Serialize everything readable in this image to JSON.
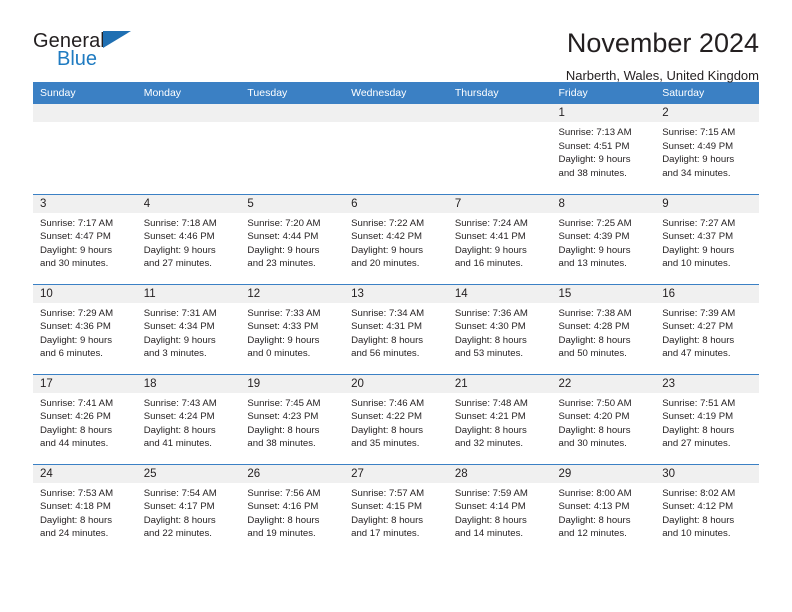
{
  "brand": {
    "name_part1": "General",
    "name_part2": "Blue",
    "mark": "triangle-logo",
    "accent_color": "#1f7bc1"
  },
  "header": {
    "title": "November 2024",
    "subtitle": "Narberth, Wales, United Kingdom"
  },
  "theme": {
    "header_row_bg": "#3b80c4",
    "daynum_strip_bg": "#f0f0f0",
    "text_color": "#231f20"
  },
  "weekdays": [
    "Sunday",
    "Monday",
    "Tuesday",
    "Wednesday",
    "Thursday",
    "Friday",
    "Saturday"
  ],
  "weeks": [
    [
      {
        "day": "",
        "empty": true
      },
      {
        "day": "",
        "empty": true
      },
      {
        "day": "",
        "empty": true
      },
      {
        "day": "",
        "empty": true
      },
      {
        "day": "",
        "empty": true
      },
      {
        "day": "1",
        "sunrise": "Sunrise: 7:13 AM",
        "sunset": "Sunset: 4:51 PM",
        "daylight_line1": "Daylight: 9 hours",
        "daylight_line2": "and 38 minutes."
      },
      {
        "day": "2",
        "sunrise": "Sunrise: 7:15 AM",
        "sunset": "Sunset: 4:49 PM",
        "daylight_line1": "Daylight: 9 hours",
        "daylight_line2": "and 34 minutes."
      }
    ],
    [
      {
        "day": "3",
        "sunrise": "Sunrise: 7:17 AM",
        "sunset": "Sunset: 4:47 PM",
        "daylight_line1": "Daylight: 9 hours",
        "daylight_line2": "and 30 minutes."
      },
      {
        "day": "4",
        "sunrise": "Sunrise: 7:18 AM",
        "sunset": "Sunset: 4:46 PM",
        "daylight_line1": "Daylight: 9 hours",
        "daylight_line2": "and 27 minutes."
      },
      {
        "day": "5",
        "sunrise": "Sunrise: 7:20 AM",
        "sunset": "Sunset: 4:44 PM",
        "daylight_line1": "Daylight: 9 hours",
        "daylight_line2": "and 23 minutes."
      },
      {
        "day": "6",
        "sunrise": "Sunrise: 7:22 AM",
        "sunset": "Sunset: 4:42 PM",
        "daylight_line1": "Daylight: 9 hours",
        "daylight_line2": "and 20 minutes."
      },
      {
        "day": "7",
        "sunrise": "Sunrise: 7:24 AM",
        "sunset": "Sunset: 4:41 PM",
        "daylight_line1": "Daylight: 9 hours",
        "daylight_line2": "and 16 minutes."
      },
      {
        "day": "8",
        "sunrise": "Sunrise: 7:25 AM",
        "sunset": "Sunset: 4:39 PM",
        "daylight_line1": "Daylight: 9 hours",
        "daylight_line2": "and 13 minutes."
      },
      {
        "day": "9",
        "sunrise": "Sunrise: 7:27 AM",
        "sunset": "Sunset: 4:37 PM",
        "daylight_line1": "Daylight: 9 hours",
        "daylight_line2": "and 10 minutes."
      }
    ],
    [
      {
        "day": "10",
        "sunrise": "Sunrise: 7:29 AM",
        "sunset": "Sunset: 4:36 PM",
        "daylight_line1": "Daylight: 9 hours",
        "daylight_line2": "and 6 minutes."
      },
      {
        "day": "11",
        "sunrise": "Sunrise: 7:31 AM",
        "sunset": "Sunset: 4:34 PM",
        "daylight_line1": "Daylight: 9 hours",
        "daylight_line2": "and 3 minutes."
      },
      {
        "day": "12",
        "sunrise": "Sunrise: 7:33 AM",
        "sunset": "Sunset: 4:33 PM",
        "daylight_line1": "Daylight: 9 hours",
        "daylight_line2": "and 0 minutes."
      },
      {
        "day": "13",
        "sunrise": "Sunrise: 7:34 AM",
        "sunset": "Sunset: 4:31 PM",
        "daylight_line1": "Daylight: 8 hours",
        "daylight_line2": "and 56 minutes."
      },
      {
        "day": "14",
        "sunrise": "Sunrise: 7:36 AM",
        "sunset": "Sunset: 4:30 PM",
        "daylight_line1": "Daylight: 8 hours",
        "daylight_line2": "and 53 minutes."
      },
      {
        "day": "15",
        "sunrise": "Sunrise: 7:38 AM",
        "sunset": "Sunset: 4:28 PM",
        "daylight_line1": "Daylight: 8 hours",
        "daylight_line2": "and 50 minutes."
      },
      {
        "day": "16",
        "sunrise": "Sunrise: 7:39 AM",
        "sunset": "Sunset: 4:27 PM",
        "daylight_line1": "Daylight: 8 hours",
        "daylight_line2": "and 47 minutes."
      }
    ],
    [
      {
        "day": "17",
        "sunrise": "Sunrise: 7:41 AM",
        "sunset": "Sunset: 4:26 PM",
        "daylight_line1": "Daylight: 8 hours",
        "daylight_line2": "and 44 minutes."
      },
      {
        "day": "18",
        "sunrise": "Sunrise: 7:43 AM",
        "sunset": "Sunset: 4:24 PM",
        "daylight_line1": "Daylight: 8 hours",
        "daylight_line2": "and 41 minutes."
      },
      {
        "day": "19",
        "sunrise": "Sunrise: 7:45 AM",
        "sunset": "Sunset: 4:23 PM",
        "daylight_line1": "Daylight: 8 hours",
        "daylight_line2": "and 38 minutes."
      },
      {
        "day": "20",
        "sunrise": "Sunrise: 7:46 AM",
        "sunset": "Sunset: 4:22 PM",
        "daylight_line1": "Daylight: 8 hours",
        "daylight_line2": "and 35 minutes."
      },
      {
        "day": "21",
        "sunrise": "Sunrise: 7:48 AM",
        "sunset": "Sunset: 4:21 PM",
        "daylight_line1": "Daylight: 8 hours",
        "daylight_line2": "and 32 minutes."
      },
      {
        "day": "22",
        "sunrise": "Sunrise: 7:50 AM",
        "sunset": "Sunset: 4:20 PM",
        "daylight_line1": "Daylight: 8 hours",
        "daylight_line2": "and 30 minutes."
      },
      {
        "day": "23",
        "sunrise": "Sunrise: 7:51 AM",
        "sunset": "Sunset: 4:19 PM",
        "daylight_line1": "Daylight: 8 hours",
        "daylight_line2": "and 27 minutes."
      }
    ],
    [
      {
        "day": "24",
        "sunrise": "Sunrise: 7:53 AM",
        "sunset": "Sunset: 4:18 PM",
        "daylight_line1": "Daylight: 8 hours",
        "daylight_line2": "and 24 minutes."
      },
      {
        "day": "25",
        "sunrise": "Sunrise: 7:54 AM",
        "sunset": "Sunset: 4:17 PM",
        "daylight_line1": "Daylight: 8 hours",
        "daylight_line2": "and 22 minutes."
      },
      {
        "day": "26",
        "sunrise": "Sunrise: 7:56 AM",
        "sunset": "Sunset: 4:16 PM",
        "daylight_line1": "Daylight: 8 hours",
        "daylight_line2": "and 19 minutes."
      },
      {
        "day": "27",
        "sunrise": "Sunrise: 7:57 AM",
        "sunset": "Sunset: 4:15 PM",
        "daylight_line1": "Daylight: 8 hours",
        "daylight_line2": "and 17 minutes."
      },
      {
        "day": "28",
        "sunrise": "Sunrise: 7:59 AM",
        "sunset": "Sunset: 4:14 PM",
        "daylight_line1": "Daylight: 8 hours",
        "daylight_line2": "and 14 minutes."
      },
      {
        "day": "29",
        "sunrise": "Sunrise: 8:00 AM",
        "sunset": "Sunset: 4:13 PM",
        "daylight_line1": "Daylight: 8 hours",
        "daylight_line2": "and 12 minutes."
      },
      {
        "day": "30",
        "sunrise": "Sunrise: 8:02 AM",
        "sunset": "Sunset: 4:12 PM",
        "daylight_line1": "Daylight: 8 hours",
        "daylight_line2": "and 10 minutes."
      }
    ]
  ]
}
